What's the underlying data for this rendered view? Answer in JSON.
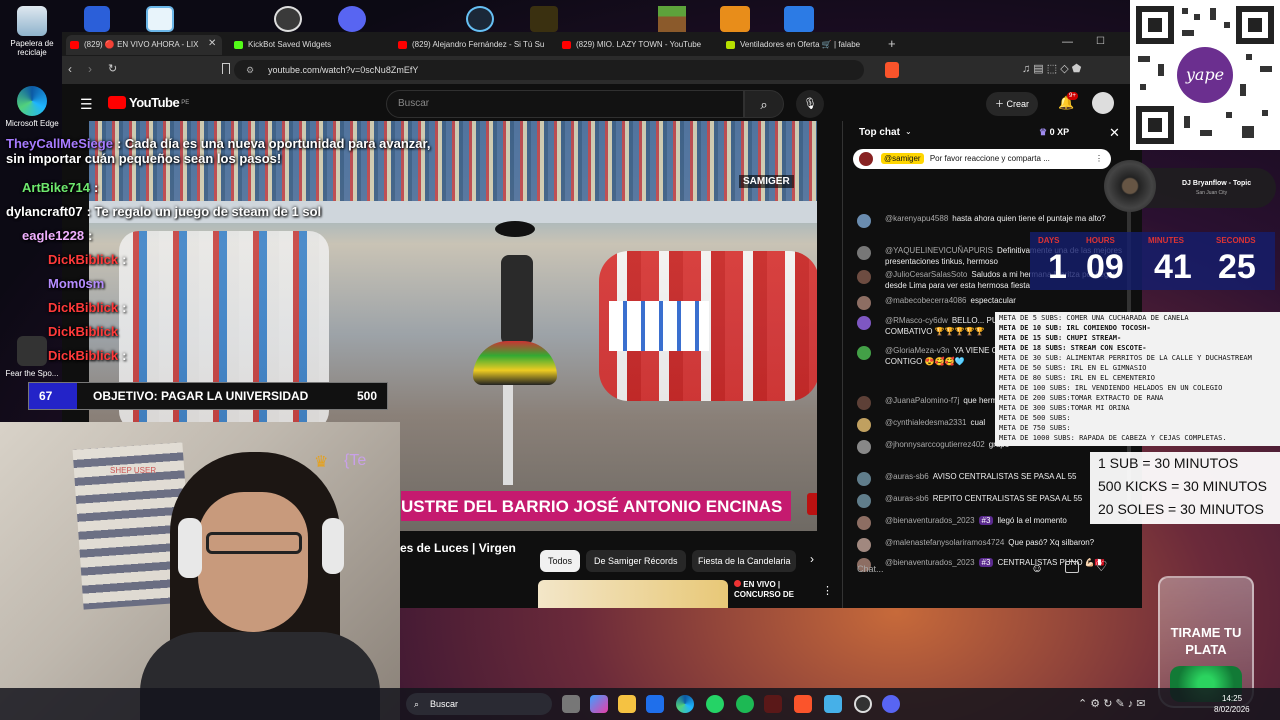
{
  "desktop": {
    "icons": [
      {
        "label": "Papelera de reciclaje",
        "icon": "recycle-bin-icon"
      },
      {
        "label": "Microsoft Edge",
        "icon": "edge-icon"
      },
      {
        "label": "Fear the Spo...",
        "icon": "game-icon"
      }
    ]
  },
  "browser": {
    "tabs": [
      {
        "label": "(829) 🔴 EN VIVO AHORA - LIX",
        "color": "#ff0000",
        "active": true
      },
      {
        "label": "KickBot Saved Widgets",
        "color": "#53fc18"
      },
      {
        "label": "(829) Alejandro Fernández - Si Tú Su",
        "color": "#ff0000"
      },
      {
        "label": "(829) MIO. LAZY TOWN - YouTube",
        "color": "#ff0000"
      },
      {
        "label": "Ventiladores en Oferta 🛒 | falabe",
        "color": "#b7e000"
      }
    ],
    "url": "youtube.com/watch?v=0scNu8ZmEfY"
  },
  "youtube": {
    "logo": "YouTube",
    "country": "PE",
    "search_placeholder": "Buscar",
    "create_label": "Crear",
    "notif_count": "9+",
    "video_banner": "USTRE DEL BARRIO JOSÉ ANTONIO ENCINAS",
    "video_watermark": "SAMIGER",
    "title_fragment": "es de Luces | Virgen",
    "chips": [
      "Todos",
      "De Samiger Récords",
      "Fiesta de la Candelaria"
    ],
    "related_live": "EN VIVO | CONCURSO DE"
  },
  "chat": {
    "header": "Top chat",
    "xp": "0 XP",
    "pinned_user": "@samiger",
    "pinned_text": "Por favor reaccione y comparta ...",
    "input_placeholder": "Chat...",
    "messages": [
      {
        "author": "@karenyapu4588",
        "text": "hasta ahora quien tiene el puntaje ma alto?",
        "color": "#6a8caf"
      },
      {
        "author": "@YAQUELINEVICUÑAPURIS",
        "text": "Definitivamente una de las mejores presentaciones tinkus, hermoso",
        "color": "#777"
      },
      {
        "author": "@JulioCesarSalasSoto",
        "text": "Saludos a mi hermana Maritza por llegar desde Lima para ver esta hermosa fiesta",
        "color": "#6d4c41"
      },
      {
        "author": "@mabecobecerra4086",
        "text": "espectacular",
        "color": "#8d6e63"
      },
      {
        "author": "@RMasco-cy6dw",
        "text": "BELLO... PUNO PUNO PUNO VALIENTE Y COMBATIVO 🏆🏆🏆🏆🏆",
        "color": "#7e57c2"
      },
      {
        "author": "@GloriaMeza-v3n",
        "text": "YA VIENE CONTIGO NICOLLE ESTAMOS CONTIGO 😍🥰🥰🩵",
        "color": "#43a047"
      },
      {
        "author": "@JuanaPalomino-f7j",
        "text": "que hermoso",
        "color": "#5d4037"
      },
      {
        "author": "@cynthialedesma2331",
        "text": "cual",
        "color": "#c0a060"
      },
      {
        "author": "@jhonnysarccogutierrez402",
        "text": "grupo",
        "color": "#888"
      },
      {
        "author": "@auras-sb6",
        "text": "AVISO CENTRALISTAS SE PASA AL 55",
        "color": "#607d8b"
      },
      {
        "author": "@auras-sb6",
        "text": "REPITO CENTRALISTAS SE PASA AL 55",
        "color": "#607d8b"
      },
      {
        "author": "@bienaventurados_2023",
        "text": "llegó la el momento",
        "color": "#8d6e63",
        "badge": "#3"
      },
      {
        "author": "@malenastefanysolariramos4724",
        "text": "Que pasó? Xq silbaron?",
        "color": "#a1887f"
      },
      {
        "author": "@bienaventurados_2023",
        "text": "CENTRALISTAS PUNO 💪🏻🇵🇪",
        "color": "#8d6e63",
        "badge": "#3"
      }
    ]
  },
  "overlay": {
    "stream_chat": [
      {
        "name": "TheyCallMeSiege",
        "text": ": Cada día es una nueva oportunidad para avanzar, sin importar cuán pequeños sean los pasos!"
      },
      {
        "name": "ArtBike714",
        "text": ":"
      },
      {
        "name": "dylancraft07",
        "text": ": Te regalo un juego de steam de 1 sol"
      },
      {
        "name": "eagle1228",
        "text": ":"
      },
      {
        "name": "DickBiblick",
        "text": ":"
      },
      {
        "name": "Mom0sm",
        "text": ""
      },
      {
        "name": "DickBiblick",
        "text": ":"
      },
      {
        "name": "DickBiblick",
        "text": ""
      },
      {
        "name": "DickBiblick",
        "text": ":"
      }
    ],
    "goal_current": "67",
    "goal_text": "OBJETIVO: PAGAR LA UNIVERSIDAD",
    "goal_target": "500",
    "goal_progress": 0.134,
    "cam_tag": "{Te",
    "cam_label": "SHEP USER",
    "music_title": "DJ Bryanflow - Topic",
    "music_sub": "San Juan City",
    "timer": {
      "labels": [
        "DAYS",
        "HOURS",
        "MINUTES",
        "SECONDS"
      ],
      "values": [
        "1",
        "09",
        "41",
        "25"
      ]
    },
    "subgoals": [
      "META DE 5 SUBS: COMER UNA CUCHARADA DE CANELA",
      "META DE 10 SUB: IRL COMIENDO TOCOSH-",
      "META DE 15 SUB: CHUPI STREAM-",
      "META DE 18 SUBS: STREAM CON ESCOTE-",
      "META DE 30 SUB:  ALIMENTAR PERRITOS DE LA CALLE Y DUCHASTREAM",
      "META DE 50 SUBS: IRL EN EL GIMNASIO",
      "META DE 80 SUBS: IRL EN EL CEMENTERIO",
      "META DE 100 SUBS: IRL VENDIENDO HELADOS EN UN COLEGIO",
      "META DE 200 SUBS:TOMAR EXTRACTO DE RANA",
      "META DE 300 SUBS:TOMAR MI ORINA",
      "META DE 500 SUBS:",
      "META DE 750 SUBS:",
      "META DE 1000 SUBS: RAPADA DE CABEZA Y CEJAS COMPLETAS."
    ],
    "rates": [
      "1 SUB = 30 MINUTOS",
      "500 KICKS = 30 MINUTOS",
      "20 SOLES = 30 MINUTOS"
    ],
    "jar_text": "TIRAME TU PLATA",
    "qr_brand": "yape"
  },
  "taskbar": {
    "search_placeholder": "Buscar",
    "time": "14:25",
    "date": "8/02/2026"
  }
}
